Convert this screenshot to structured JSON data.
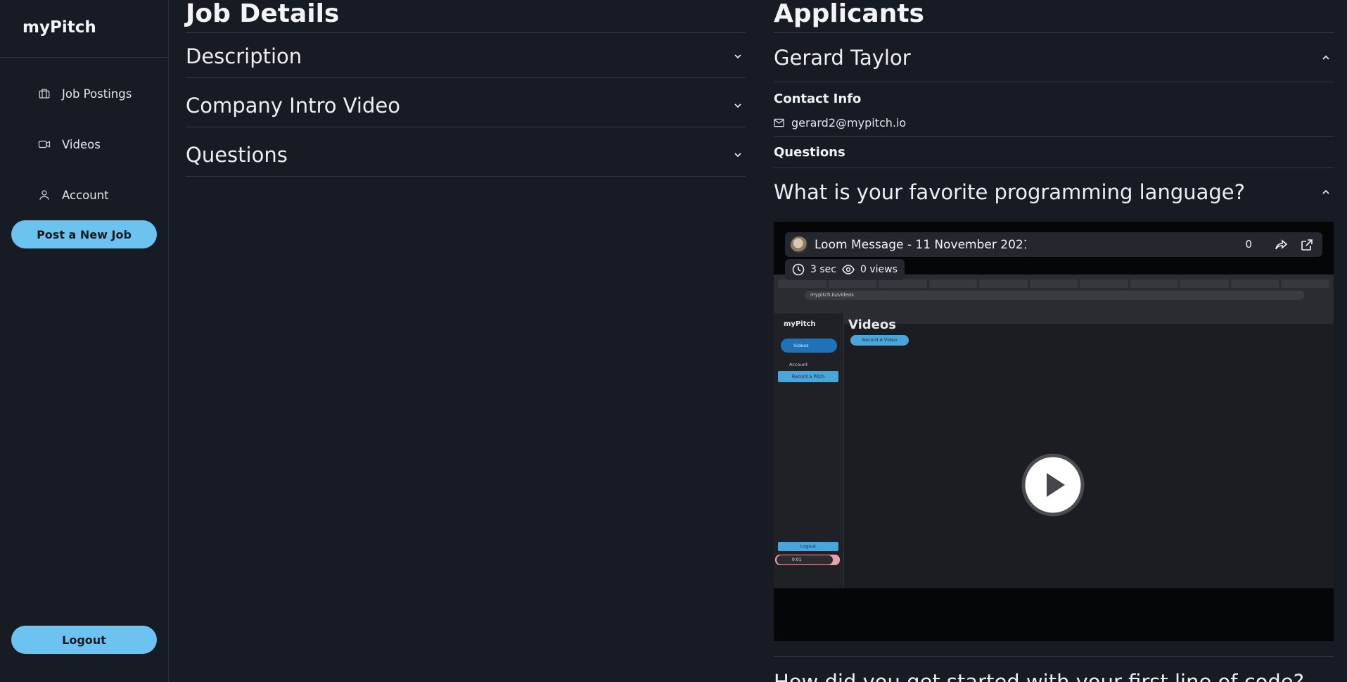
{
  "brand": "myPitch",
  "sidebar": {
    "items": [
      {
        "label": "Job Postings",
        "icon": "briefcase-icon"
      },
      {
        "label": "Videos",
        "icon": "video-camera-icon"
      },
      {
        "label": "Account",
        "icon": "user-icon"
      }
    ],
    "post_job_label": "Post a New Job",
    "logout_label": "Logout"
  },
  "job_details": {
    "title": "Job Details",
    "sections": [
      {
        "label": "Description",
        "expanded": false
      },
      {
        "label": "Company Intro Video",
        "expanded": false
      },
      {
        "label": "Questions",
        "expanded": false
      }
    ]
  },
  "applicants": {
    "title": "Applicants",
    "applicant": {
      "name": "Gerard Taylor",
      "expanded": true,
      "contact_heading": "Contact Info",
      "email": "gerard2@mypitch.io",
      "questions_heading": "Questions",
      "question": "What is your favorite programming language?",
      "next_question_partial": "How did you get started with your first line of code?"
    }
  },
  "video": {
    "title": "Loom Message - 11 November 2021",
    "count": "0",
    "duration": "3 sec",
    "views": "0 views",
    "screenshot": {
      "brand": "myPitch",
      "nav_active": "Videos",
      "nav_account": "Account",
      "record_pitch": "Record a Pitch",
      "logout": "Logout",
      "heading": "Videos",
      "record_video": "Record A Video",
      "url": "mypitch.io/videos",
      "rec_time": "0:01"
    }
  },
  "colors": {
    "background": "#171b24",
    "accent": "#6cc3f0",
    "text": "#e9ebef",
    "divider": "#343945"
  }
}
